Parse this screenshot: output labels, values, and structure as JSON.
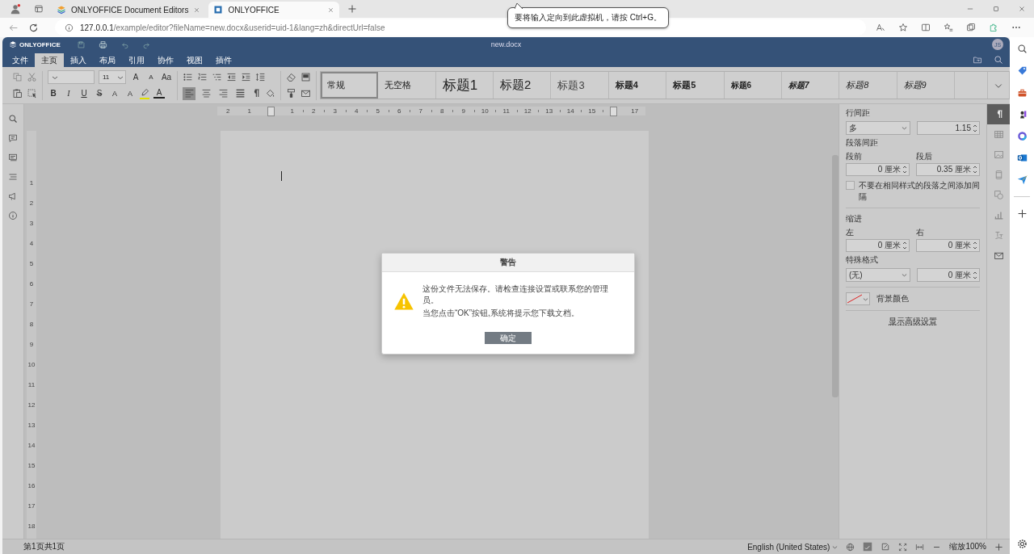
{
  "browser": {
    "tabs": [
      {
        "title": "ONLYOFFICE Document Editors",
        "selected": false
      },
      {
        "title": "ONLYOFFICE",
        "selected": true
      }
    ],
    "url_host": "127.0.0.1",
    "url_path": "/example/editor?fileName=new.docx&userid=uid-1&lang=zh&directUrl=false",
    "tooltip": "要将输入定向到此虚拟机，请按 Ctrl+G。"
  },
  "editor": {
    "logo": "ONLYOFFICE",
    "doc_title": "new.docx",
    "user_initials": "JS",
    "menu_tabs": [
      {
        "label": "文件",
        "selected": false
      },
      {
        "label": "主页",
        "selected": true
      },
      {
        "label": "插入",
        "selected": false
      },
      {
        "label": "布局",
        "selected": false
      },
      {
        "label": "引用",
        "selected": false
      },
      {
        "label": "协作",
        "selected": false
      },
      {
        "label": "视图",
        "selected": false
      },
      {
        "label": "插件",
        "selected": false
      }
    ],
    "toolbar": {
      "font_size": "11",
      "font_top": [
        {
          "kind": "grow",
          "glyph": "A"
        },
        {
          "kind": "shrink",
          "glyph": "A"
        },
        {
          "kind": "case",
          "glyph": "Aa"
        }
      ],
      "font_bottom": [
        {
          "kind": "bold",
          "glyph": "B"
        },
        {
          "kind": "italic",
          "glyph": "I"
        },
        {
          "kind": "underline",
          "glyph": "U"
        },
        {
          "kind": "strike",
          "glyph": "S"
        },
        {
          "kind": "superscript",
          "glyph": "A"
        },
        {
          "kind": "subscript",
          "glyph": "A"
        },
        {
          "kind": "highlight"
        },
        {
          "kind": "color",
          "glyph": "A"
        }
      ],
      "alignment": [
        {
          "kind": "left",
          "selected": true
        },
        {
          "kind": "center",
          "selected": false
        },
        {
          "kind": "right",
          "selected": false
        },
        {
          "kind": "justify",
          "selected": false
        }
      ],
      "styles": [
        {
          "label": "常规",
          "kind": "plain",
          "selected": true
        },
        {
          "label": "无空格",
          "kind": "plain",
          "selected": false
        },
        {
          "label": "标题1",
          "kind": "h1",
          "selected": false
        },
        {
          "label": "标题2",
          "kind": "h2",
          "selected": false
        },
        {
          "label": "标题3",
          "kind": "h3",
          "selected": false
        },
        {
          "label": "标题4",
          "kind": "bold",
          "selected": false
        },
        {
          "label": "标题5",
          "kind": "bold",
          "selected": false
        },
        {
          "label": "标题6",
          "kind": "bold-small",
          "selected": false
        },
        {
          "label": "标题7",
          "kind": "bold-italic",
          "selected": false
        },
        {
          "label": "标题8",
          "kind": "italic",
          "selected": false
        },
        {
          "label": "标题9",
          "kind": "italic",
          "selected": false
        }
      ]
    },
    "ruler": {
      "left_labels": [
        "2",
        "1"
      ],
      "body_labels": [
        "1",
        "2",
        "3",
        "4",
        "5",
        "6",
        "7",
        "8",
        "9",
        "10",
        "11",
        "12",
        "13",
        "14",
        "15"
      ],
      "right_labels": [
        "17"
      ],
      "vertical_labels": [
        "1",
        "2",
        "3",
        "4",
        "5",
        "6",
        "7",
        "8",
        "9",
        "10",
        "11",
        "12",
        "13",
        "14",
        "15",
        "16",
        "17",
        "18"
      ]
    },
    "panel": {
      "line_spacing_label": "行间距",
      "line_spacing_mode": "多",
      "line_spacing_value": "1.15",
      "paragraph_spacing_label": "段落间距",
      "before_label": "段前",
      "before_value": "0 厘米",
      "after_label": "段后",
      "after_value": "0.35 厘米",
      "no_space_label": "不要在相同样式的段落之间添加间隔",
      "no_space_checked": false,
      "indent_label": "缩进",
      "left_label": "左",
      "left_value": "0 厘米",
      "right_label": "右",
      "right_value": "0 厘米",
      "special_label": "特殊格式",
      "special_mode": "(无)",
      "special_value": "0 厘米",
      "background_label": "背景颜色",
      "advanced_link": "显示高级设置"
    },
    "right_tabs": [
      {
        "kind": "paragraph",
        "selected": true
      },
      {
        "kind": "table",
        "selected": false
      },
      {
        "kind": "image",
        "selected": false
      },
      {
        "kind": "header",
        "selected": false
      },
      {
        "kind": "shape",
        "selected": false
      },
      {
        "kind": "chart",
        "selected": false
      },
      {
        "kind": "textart",
        "selected": false
      },
      {
        "kind": "mail",
        "selected": false
      }
    ],
    "dialog": {
      "title": "警告",
      "message": [
        "这份文件无法保存。请检查连接设置或联系您的管理员。",
        "当您点击“OK”按钮,系统将提示您下载文档。"
      ],
      "button": "确定"
    },
    "status_bar": {
      "page_info": "第1页共1页",
      "language": "English (United States)",
      "zoom": "缩放100%"
    }
  }
}
